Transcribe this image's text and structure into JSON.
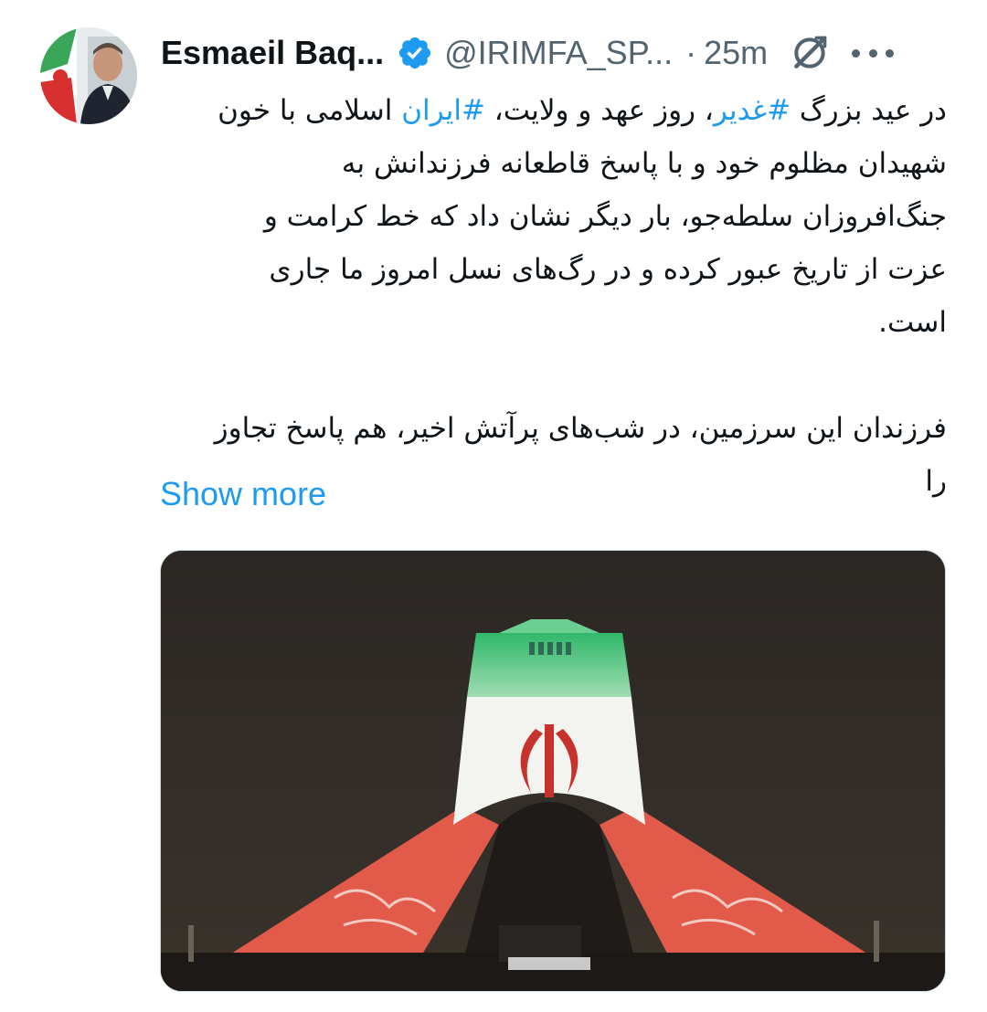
{
  "tweet": {
    "author_name": "Esmaeil Baq...",
    "handle": "@IRIMFA_SP...",
    "separator": "·",
    "time": "25m",
    "text_lines": {
      "l1_a": "در عید بزرگ ",
      "l1_tag1": "#غدیر",
      "l1_b": "، روز عهد و ولایت، ",
      "l1_tag2": "#ایران",
      "l1_c": " اسلامی با خون",
      "l2": "شهیدان مظلوم خود و با پاسخ قاطعانه فرزندانش به",
      "l3": "جنگ‌افروزان سلطه‌جو، بار دیگر نشان داد که خط کرامت و",
      "l4": "عزت از تاریخ عبور کرده و در رگ‌های نسل امروز ما جاری",
      "l5": "است.",
      "l6": "فرزندان این سرزمین، در شب‌های پرآتش اخیر، هم پاسخ تجاوز",
      "l7": "را"
    },
    "show_more": "Show more"
  },
  "icons": {
    "verified": "verified-badge-icon",
    "grok": "grok-icon",
    "more": "more-options-icon"
  },
  "colors": {
    "accent": "#1d9bf0",
    "text": "#0f1419",
    "secondary": "#536471"
  }
}
